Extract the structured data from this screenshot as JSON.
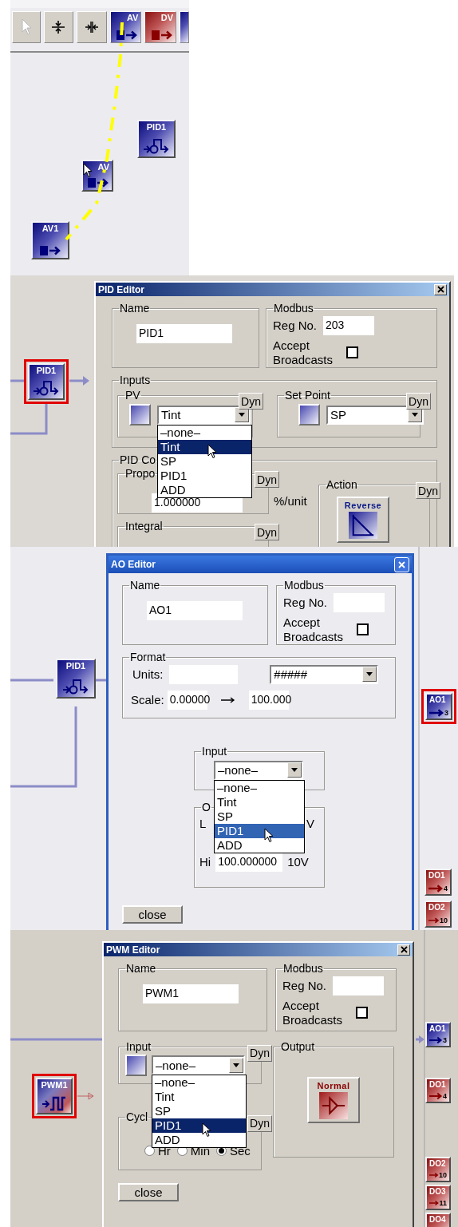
{
  "designer": {
    "toolbar": [
      {
        "kind": "pointer"
      },
      {
        "kind": "hsplit"
      },
      {
        "kind": "vsplit"
      },
      {
        "kind": "av",
        "label": "AV"
      },
      {
        "kind": "dv",
        "label": "DV"
      },
      {
        "kind": "partial"
      }
    ],
    "nodes": [
      {
        "kind": "pid",
        "label": "PID1",
        "selected": false
      },
      {
        "kind": "av",
        "label": "AV",
        "selected": false
      },
      {
        "kind": "av",
        "label": "AV1",
        "selected": false
      }
    ]
  },
  "pid_view": {
    "nodes": [
      {
        "kind": "pid",
        "label": "PID1",
        "selected": true
      }
    ],
    "editor": {
      "kind": "classic",
      "title": "PID Editor",
      "name": {
        "legend": "Name",
        "value": "PID1"
      },
      "modbus": {
        "legend": "Modbus",
        "reg_label": "Reg No.",
        "reg_value": "203",
        "broadcast_label": "Accept Broadcasts",
        "broadcast_checked": false
      },
      "inputs": {
        "legend": "Inputs",
        "pv": {
          "legend": "PV",
          "dyn": "Dyn",
          "value": "Tint",
          "options": [
            {
              "label": "–none–",
              "highlighted": false
            },
            {
              "label": "Tint",
              "highlighted": true
            },
            {
              "label": "SP",
              "highlighted": false
            },
            {
              "label": "PID1",
              "highlighted": false
            },
            {
              "label": "ADD",
              "highlighted": false
            }
          ]
        },
        "set_point": {
          "legend": "Set Point",
          "dyn": "Dyn",
          "value": "SP"
        }
      },
      "control": {
        "legend": "PID Co",
        "proportional": {
          "legend": "Propo",
          "dyn": "Dyn",
          "value": "1.000000",
          "unit": "%/unit"
        },
        "integral": {
          "legend": "Integral",
          "dyn": "Dyn"
        },
        "action": {
          "legend": "Action",
          "dyn": "Dyn",
          "button": "Reverse"
        }
      }
    }
  },
  "ao_view": {
    "nodes": [
      {
        "kind": "pid",
        "label": "PID1",
        "selected": false
      }
    ],
    "strip": [
      {
        "kind": "ao",
        "label": "AO1",
        "number": "3",
        "selected": true
      },
      {
        "kind": "do",
        "label": "DO1",
        "number": "4",
        "selected": false
      },
      {
        "kind": "do",
        "label": "DO2",
        "number": "10",
        "selected": false
      }
    ],
    "editor": {
      "kind": "xp",
      "title": "AO Editor",
      "name": {
        "legend": "Name",
        "value": "AO1"
      },
      "modbus": {
        "legend": "Modbus",
        "reg_label": "Reg No.",
        "broadcast_label": "Accept Broadcasts",
        "broadcast_checked": false
      },
      "format": {
        "legend": "Format",
        "units_label": "Units:",
        "display": "#####",
        "scale_label": "Scale:",
        "scale_from": "0.00000",
        "scale_to": "100.000"
      },
      "input": {
        "legend": "Input",
        "value": "–none–",
        "options": [
          {
            "label": "–none–",
            "highlighted": false
          },
          {
            "label": "Tint",
            "highlighted": false
          },
          {
            "label": "SP",
            "highlighted": false
          },
          {
            "label": "PID1",
            "highlighted": true
          },
          {
            "label": "ADD",
            "highlighted": false
          }
        ]
      },
      "output": {
        "legend": "O",
        "lo_label": "L",
        "lo_unit": "V",
        "hi_label": "Hi",
        "hi_value": "100.000000",
        "hi_unit": "10V"
      },
      "close": "close"
    }
  },
  "pwm_view": {
    "nodes": [
      {
        "kind": "pwm",
        "label": "PWM1",
        "selected": true
      }
    ],
    "strip": [
      {
        "kind": "ao",
        "label": "AO1",
        "number": "3",
        "selected": false
      },
      {
        "kind": "do",
        "label": "DO1",
        "number": "4",
        "selected": false
      },
      {
        "kind": "do",
        "label": "DO2",
        "number": "10",
        "selected": false
      },
      {
        "kind": "do",
        "label": "DO3",
        "number": "11",
        "selected": false
      },
      {
        "kind": "do",
        "label": "DO4",
        "selected": false
      }
    ],
    "editor": {
      "kind": "classic",
      "title": "PWM Editor",
      "name": {
        "legend": "Name",
        "value": "PWM1"
      },
      "modbus": {
        "legend": "Modbus",
        "reg_label": "Reg No.",
        "broadcast_label": "Accept Broadcasts",
        "broadcast_checked": false
      },
      "input": {
        "legend": "Input",
        "dyn": "Dyn",
        "value": "–none–",
        "options": [
          {
            "label": "–none–",
            "highlighted": false
          },
          {
            "label": "Tint",
            "highlighted": false
          },
          {
            "label": "SP",
            "highlighted": false
          },
          {
            "label": "PID1",
            "highlighted": true
          },
          {
            "label": "ADD",
            "highlighted": false
          }
        ]
      },
      "cycle": {
        "legend": "Cycl",
        "dyn": "Dyn",
        "units": [
          {
            "label": "Hr",
            "selected": false
          },
          {
            "label": "Min",
            "selected": false
          },
          {
            "label": "Sec",
            "selected": true
          }
        ]
      },
      "output": {
        "legend": "Output",
        "button": "Normal"
      },
      "close": "close"
    }
  }
}
